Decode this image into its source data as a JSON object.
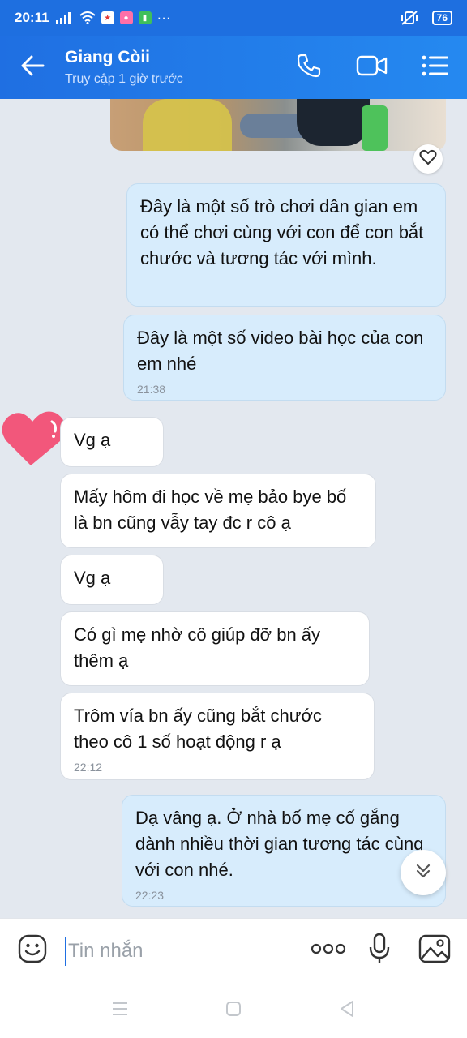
{
  "status_bar": {
    "time": "20:11",
    "battery": "76",
    "notif_icons": [
      "signal-icon",
      "wifi-icon",
      "app-notification-icon",
      "app-notification-icon",
      "app-notification-icon"
    ],
    "overflow": "···"
  },
  "header": {
    "contact_name": "Giang Còii",
    "contact_status": "Truy cập 1 giờ trước",
    "icons": [
      "back-arrow-icon",
      "phone-icon",
      "video-call-icon",
      "menu-icon"
    ],
    "accent": "#1f6fe2"
  },
  "messages": [
    {
      "direction": "out",
      "text": "Đây là một số trò chơi dân gian em có thể chơi cùng với con để con bắt chước và tương tác với mình.",
      "time": ""
    },
    {
      "direction": "out",
      "text": "Đây là một số video bài học của con em nhé",
      "time": "21:38"
    },
    {
      "direction": "in",
      "text": "Vg ạ",
      "time": ""
    },
    {
      "direction": "in",
      "text": "Mấy hôm đi học về mẹ bảo bye bố là bn cũng vẫy tay đc r cô ạ",
      "time": ""
    },
    {
      "direction": "in",
      "text": "Vg ạ",
      "time": ""
    },
    {
      "direction": "in",
      "text": "Có gì mẹ nhờ cô giúp đỡ bn ấy thêm ạ",
      "time": ""
    },
    {
      "direction": "in",
      "text": "Trôm vía bn ấy cũng bắt chước theo cô 1 số hoạt động r ạ",
      "time": "22:12"
    },
    {
      "direction": "out",
      "text": "Dạ vâng ạ. Ở nhà bố mẹ cố gắng dành nhiều thời gian tương tác cùng với con nhé.",
      "time": "22:23"
    }
  ],
  "composer": {
    "placeholder": "Tin nhắn",
    "icons": [
      "emoji-icon",
      "more-options-icon",
      "microphone-icon",
      "image-icon"
    ]
  },
  "nav_icons": [
    "recent-apps-icon",
    "home-icon",
    "back-icon"
  ],
  "colors": {
    "outgoing_bubble": "#d7ecfc",
    "incoming_bubble": "#ffffff",
    "reaction_heart": "#f2577b"
  }
}
